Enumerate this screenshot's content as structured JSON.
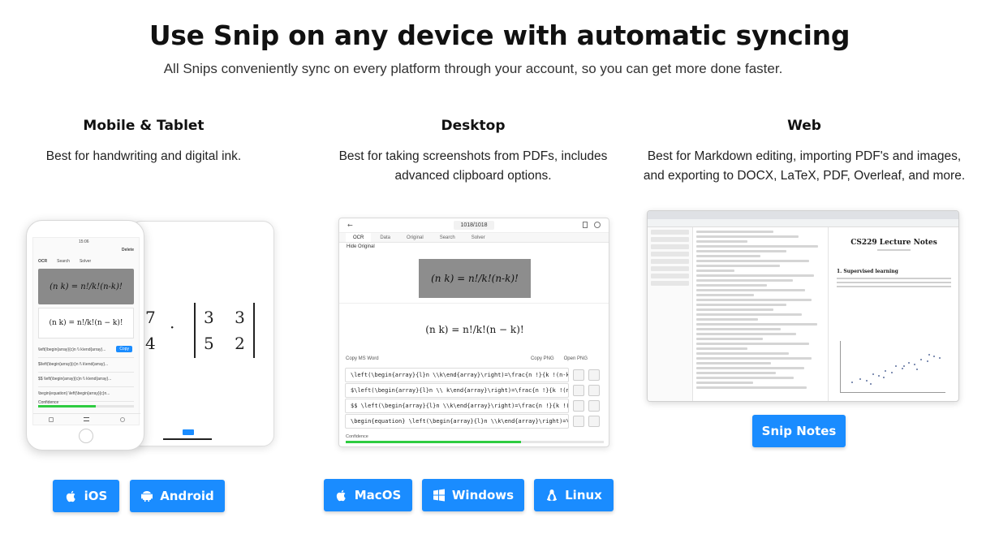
{
  "header": {
    "title": "Use Snip on any device with automatic syncing",
    "subtitle": "All Snips conveniently sync on every platform through your account, so you can get more done faster."
  },
  "columns": {
    "mobile": {
      "title": "Mobile & Tablet",
      "desc": "Best for handwriting and digital ink."
    },
    "desktop": {
      "title": "Desktop",
      "desc": "Best for taking screenshots from PDFs, includes advanced clipboard options."
    },
    "web": {
      "title": "Web",
      "desc": "Best for Markdown editing, importing PDF's and images, and exporting to DOCX, LaTeX, PDF, Overleaf, and more."
    }
  },
  "buttons": {
    "ios": {
      "label": "iOS",
      "icon": "apple-icon"
    },
    "android": {
      "label": "Android",
      "icon": "android-icon"
    },
    "macos": {
      "label": "MacOS",
      "icon": "apple-icon"
    },
    "windows": {
      "label": "Windows",
      "icon": "windows-icon"
    },
    "linux": {
      "label": "Linux",
      "icon": "linux-icon"
    },
    "snip_notes": {
      "label": "Snip Notes"
    }
  },
  "phone_mock": {
    "status_time": "15:06",
    "delete": "Delete",
    "tabs": [
      "OCR",
      "Search",
      "Solver"
    ],
    "handwritten": "(n k) = n!/k!(n-k)!",
    "rendered": "(n k) = n!/k!(n − k)!",
    "results": [
      "\\left(\\begin{array}{c}n \\\\ k\\end{array}...",
      "$\\left(\\begin{array}{c}n \\\\ k\\end{array}...",
      "$$ \\left(\\begin{array}{c}n \\\\ k\\end{array}...",
      "\\begin{equation} \\left(\\begin{array}{c}n..."
    ],
    "copy_label": "Copy",
    "confidence": "Confidence",
    "confidence_value": 0.6
  },
  "tablet_mock": {
    "matrix_left": [
      "7",
      "4"
    ],
    "matrix_right": [
      "3",
      "3",
      "5",
      "2"
    ]
  },
  "desktop_mock": {
    "page_indicator": "1018/1018",
    "tabs": [
      "OCR",
      "Data",
      "Original",
      "Search",
      "Solver"
    ],
    "hide_original": "Hide Original",
    "handwritten": "(n k) = n!/k!(n-k)!",
    "rendered": "(n k) = n!/k!(n − k)!",
    "copy_ms_word": "Copy MS Word",
    "copy_png": "Copy PNG",
    "open_png": "Open PNG",
    "results": [
      "\\left(\\begin{array}{l}n \\\\k\\end{array}\\right)=\\frac{n !}{k !(n-k)...",
      "$\\left(\\begin{array}{l}n \\\\ k\\end{array}\\right)=\\frac{n !}{k !(n-k...",
      "$$ \\left(\\begin{array}{l}n \\\\k\\end{array}\\right)=\\frac{n !}{k !(n-...",
      "\\begin{equation} \\left(\\begin{array}{l}n \\\\k\\end{array}\\right)=\\fr..."
    ],
    "confidence": "Confidence",
    "confidence_value": 0.68
  },
  "web_mock": {
    "doc_title": "CS229 Lecture Notes",
    "section": "1. Supervised learning"
  },
  "colors": {
    "accent": "#1a8cff",
    "confidence": "#2ecc40"
  }
}
